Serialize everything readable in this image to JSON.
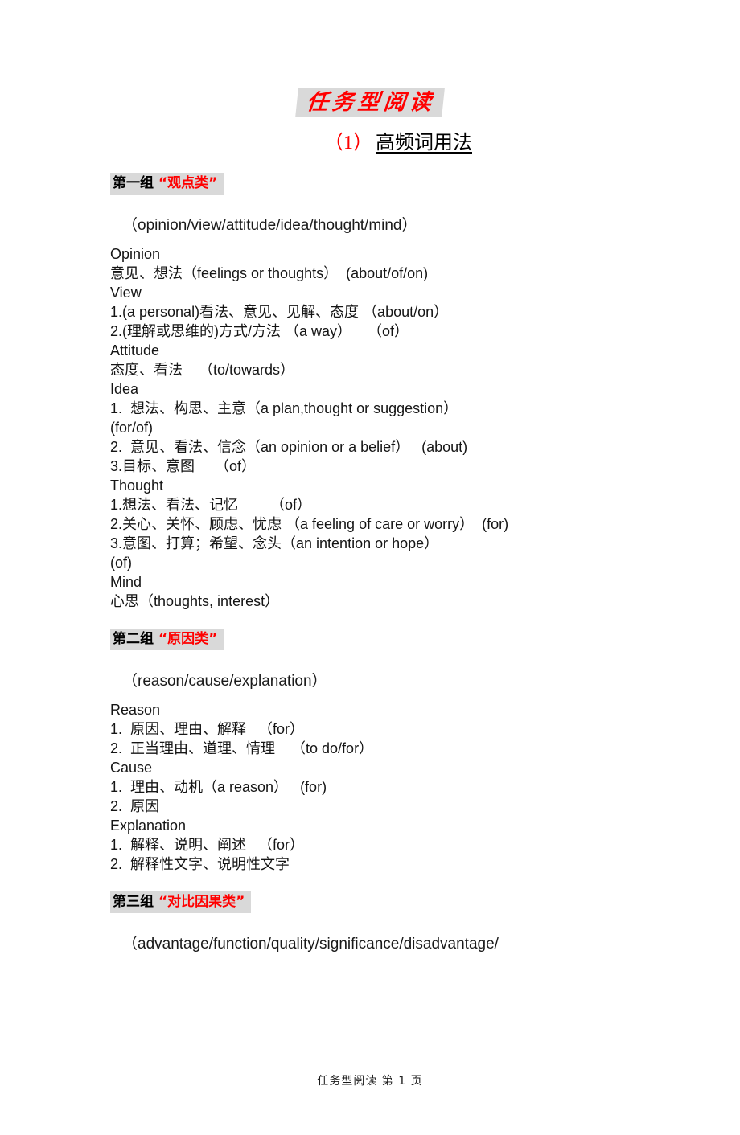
{
  "document": {
    "title": "任务型阅读",
    "subtitle_number": "（1）",
    "subtitle_text": "高频词用法",
    "footer": "任务型阅读  第 1 页"
  },
  "colors": {
    "accent_red": "#ff0000",
    "highlight_gray": "#d9d9d9",
    "text_black": "#000000"
  },
  "groups": [
    {
      "heading_cn": "第一组",
      "heading_quote": "“观点类”",
      "word_list": "（opinion/view/attitude/idea/thought/mind）",
      "lines": [
        "Opinion",
        "意见、想法（feelings or thoughts）  (about/of/on)",
        "View",
        "1.(a personal)看法、意见、见解、态度 （about/on）",
        "2.(理解或思维的)方式/方法 （a way）    （of）",
        "Attitude",
        "态度、看法    （to/towards）",
        "Idea",
        "1.  想法、构思、主意（a plan,thought or suggestion）",
        "(for/of)",
        "2.  意见、看法、信念（an opinion or a belief）   (about)",
        "3.目标、意图     （of）",
        "Thought",
        "1.想法、看法、记忆        （of）",
        "2.关心、关怀、顾虑、忧虑 （a feeling of care or worry）  (for)",
        "3.意图、打算；希望、念头（an intention or hope）",
        "(of)",
        "Mind",
        "心思（thoughts, interest）"
      ]
    },
    {
      "heading_cn": "第二组",
      "heading_quote": "“原因类”",
      "word_list": "（reason/cause/explanation）",
      "lines": [
        "Reason",
        "1.  原因、理由、解释   （for）",
        "2.  正当理由、道理、情理    （to do/for）",
        "Cause",
        "1.  理由、动机（a reason）   (for)",
        "2.  原因",
        "Explanation",
        "1.  解释、说明、阐述   （for）",
        "2.  解释性文字、说明性文字"
      ]
    },
    {
      "heading_cn": "第三组",
      "heading_quote": "“对比因果类”",
      "word_list": "（advantage/function/quality/significance/disadvantage/",
      "lines": []
    }
  ]
}
